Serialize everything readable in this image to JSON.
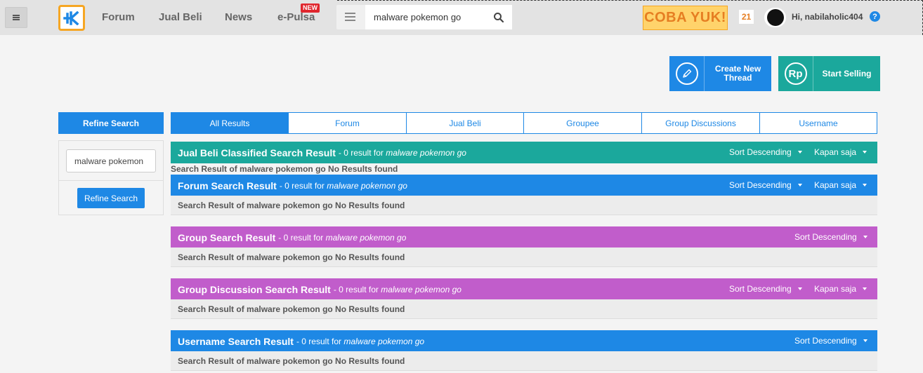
{
  "header": {
    "nav": [
      "Forum",
      "Jual Beli",
      "News",
      "e-Pulsa"
    ],
    "new_badge": "NEW",
    "search_value": "malware pokemon go",
    "promo": "COBA YUK!",
    "notifications": "21",
    "greeting": "Hi, nabilaholic404",
    "help": "?"
  },
  "actions": {
    "create": "Create New Thread",
    "sell": "Start Selling",
    "sell_icon": "Rp"
  },
  "sidebar": {
    "title": "Refine Search",
    "query": "malware pokemon",
    "button": "Refine Search"
  },
  "tabs": [
    "All Results",
    "Forum",
    "Jual Beli",
    "Groupee",
    "Group Discussions",
    "Username"
  ],
  "sort_label": "Sort Descending",
  "time_label": "Kapan saja",
  "results": [
    {
      "title": "Jual Beli Classified Search Result",
      "count": "- 0 result for",
      "query": "malware pokemon go",
      "empty": "Search Result of malware pokemon go No Results found"
    },
    {
      "title": "Forum Search Result",
      "count": "- 0 result for",
      "query": "malware pokemon go",
      "empty": "Search Result of malware pokemon go No Results found"
    },
    {
      "title": "Group Search Result",
      "count": "- 0 result for",
      "query": "malware pokemon go",
      "empty": "Search Result of malware pokemon go No Results found"
    },
    {
      "title": "Group Discussion Search Result",
      "count": "- 0 result for",
      "query": "malware pokemon go",
      "empty": "Search Result of malware pokemon go No Results found"
    },
    {
      "title": "Username Search Result",
      "count": "- 0 result for",
      "query": "malware pokemon go",
      "empty": "Search Result of malware pokemon go No Results found"
    }
  ],
  "colors": {
    "blue": "#1e88e5",
    "teal": "#1ba89c",
    "purple": "#c15dcb",
    "logo_border": "#f6a623"
  },
  "icons": [
    "menu-icon",
    "kaskus-logo-icon",
    "search-icon",
    "pencil-icon",
    "rupiah-icon",
    "help-icon",
    "caret-down-icon"
  ]
}
